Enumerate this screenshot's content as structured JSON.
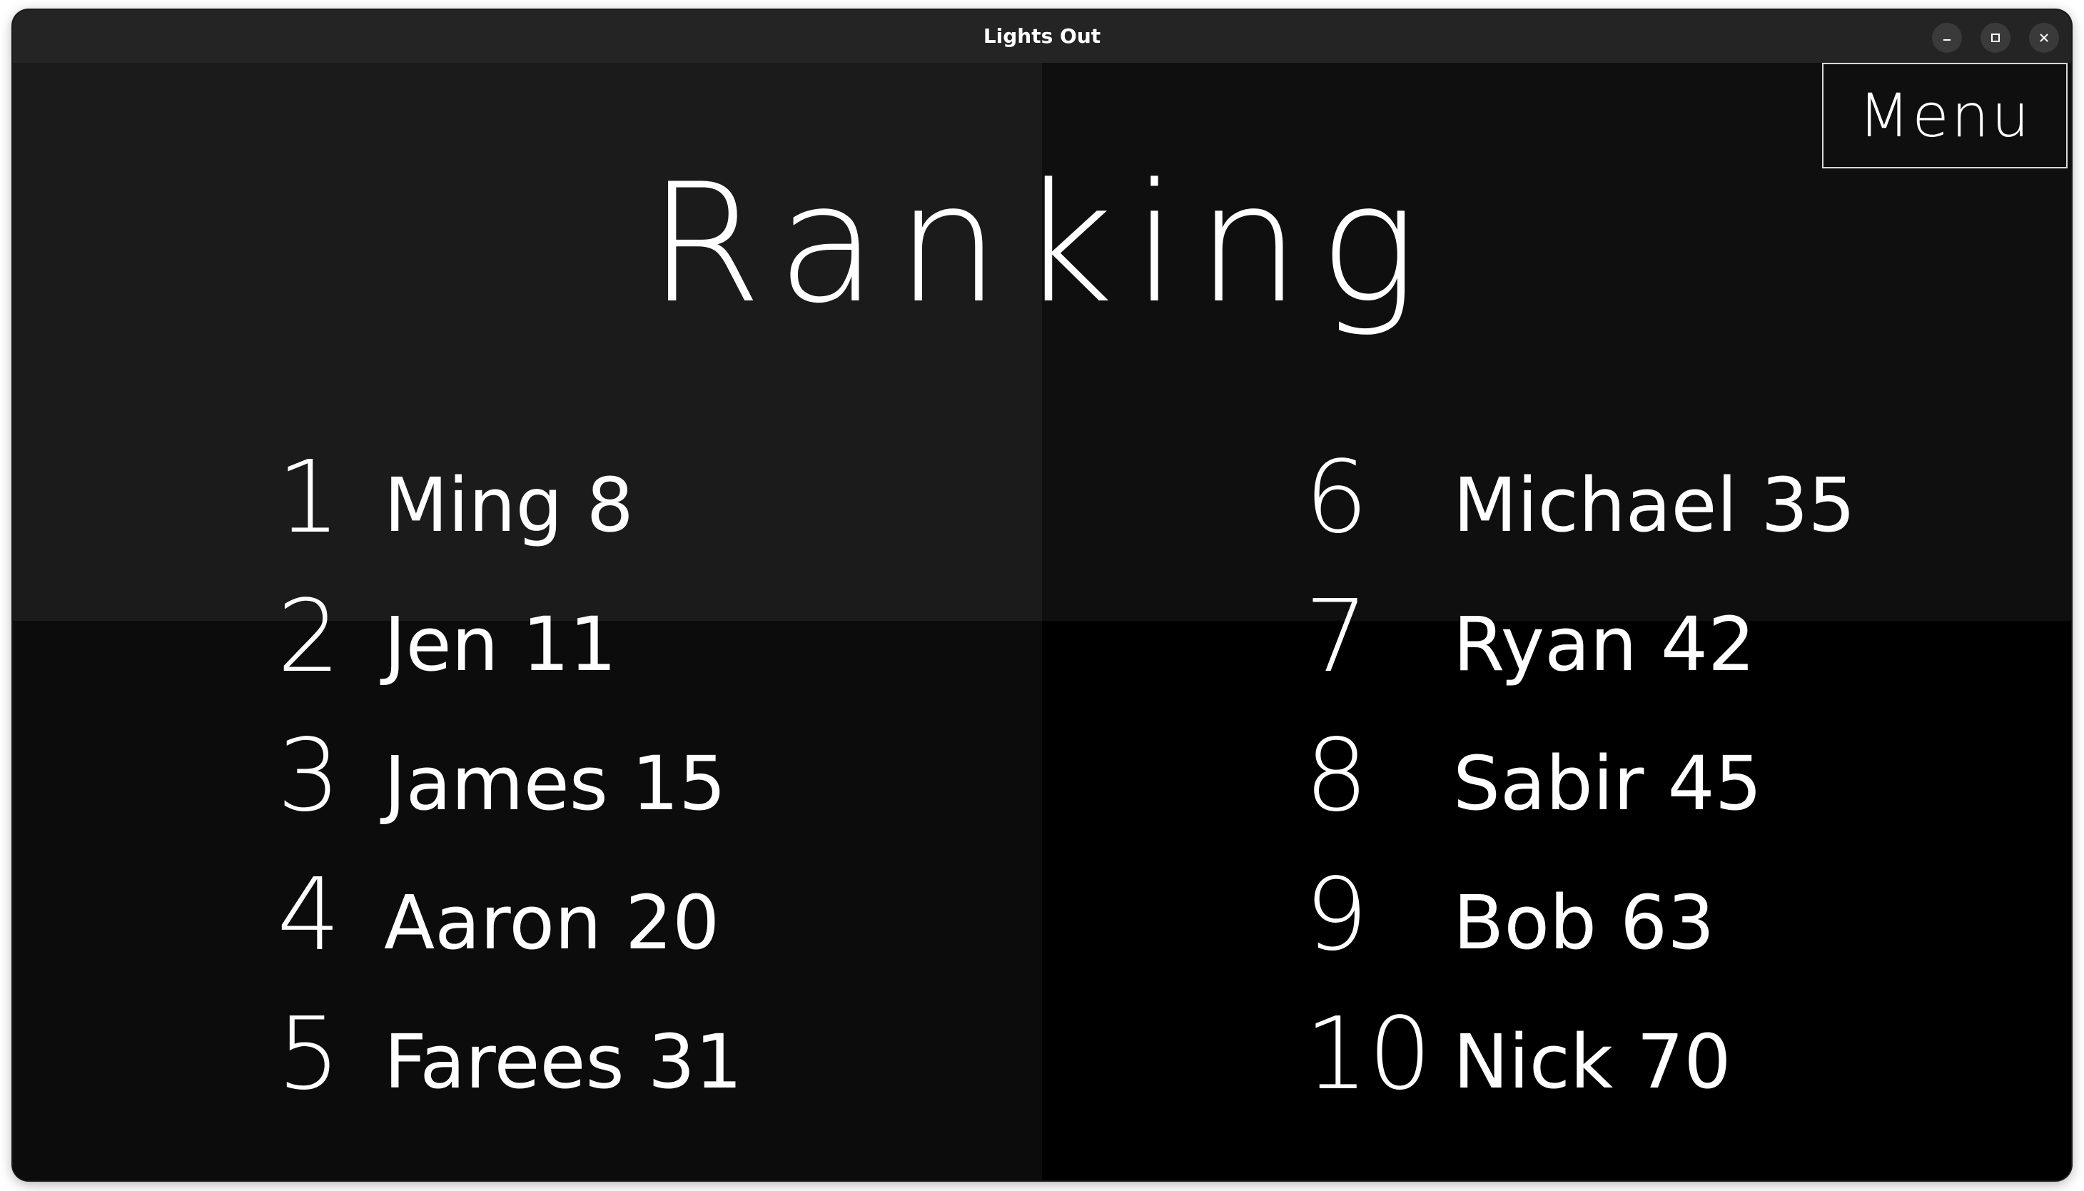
{
  "window": {
    "title": "Lights Out"
  },
  "menu": {
    "label": "Menu"
  },
  "page": {
    "heading": "Ranking"
  },
  "rankings": [
    {
      "rank": "1",
      "entry": "Ming 8"
    },
    {
      "rank": "2",
      "entry": "Jen 11"
    },
    {
      "rank": "3",
      "entry": "James 15"
    },
    {
      "rank": "4",
      "entry": "Aaron 20"
    },
    {
      "rank": "5",
      "entry": "Farees 31"
    },
    {
      "rank": "6",
      "entry": "Michael 35"
    },
    {
      "rank": "7",
      "entry": "Ryan 42"
    },
    {
      "rank": "8",
      "entry": "Sabir 45"
    },
    {
      "rank": "9",
      "entry": "Bob 63"
    },
    {
      "rank": "10",
      "entry": "Nick 70"
    }
  ],
  "colors": {
    "titlebar": "#242424",
    "quad_top_left": "#1b1b1b",
    "quad_top_right": "#0f0f0f",
    "quad_bottom_left": "#0c0c0c",
    "quad_bottom_right": "#000000",
    "text": "#ffffff"
  }
}
